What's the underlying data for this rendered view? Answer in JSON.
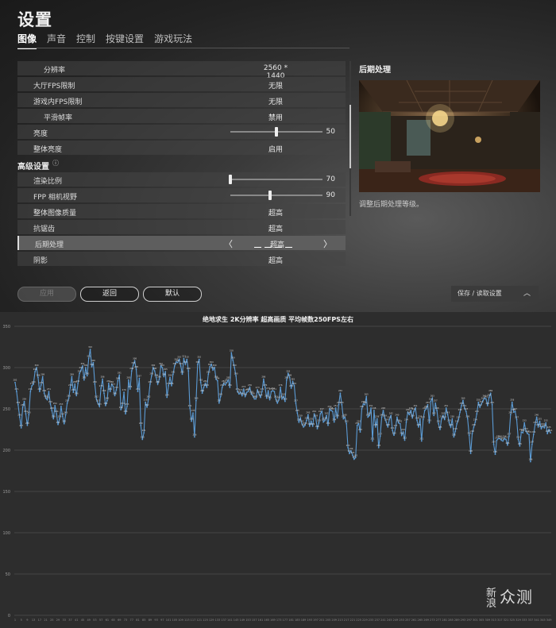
{
  "game": {
    "title": "设置",
    "tabs": [
      {
        "label": "图像",
        "active": true
      },
      {
        "label": "声音",
        "active": false
      },
      {
        "label": "控制",
        "active": false
      },
      {
        "label": "按键设置",
        "active": false
      },
      {
        "label": "游戏玩法",
        "active": false
      }
    ],
    "settings": [
      {
        "label": "分辨率",
        "value": "2560 * 1440",
        "indent": true
      },
      {
        "label": "大厅FPS限制",
        "value": "无限"
      },
      {
        "label": "游戏内FPS限制",
        "value": "无限"
      },
      {
        "label": "平滑帧率",
        "value": "禁用",
        "indent": true
      },
      {
        "label": "亮度",
        "slider": 0.5,
        "value": "50"
      },
      {
        "label": "整体亮度",
        "value": "启用"
      },
      {
        "label": "高级设置",
        "section": true,
        "icon": "info-icon"
      },
      {
        "label": "渲染比例",
        "slider": 0.0,
        "value": "70"
      },
      {
        "label": "FPP 相机视野",
        "slider": 0.43,
        "value": "90"
      },
      {
        "label": "整体图像质量",
        "value": "超高"
      },
      {
        "label": "抗锯齿",
        "value": "超高"
      },
      {
        "label": "后期处理",
        "value": "超高",
        "selected": true,
        "level": 4,
        "levels": 4
      },
      {
        "label": "阴影",
        "value": "超高"
      }
    ],
    "preview_title": "后期处理",
    "preview_desc": "调整后期处理等级。",
    "buttons": {
      "apply": "应用",
      "back": "返回",
      "default": "默认"
    },
    "save_load": "保存 / 读取设置",
    "colors": {
      "line": "#5b9bd5",
      "selected_row": "#5e5e5e"
    }
  },
  "chart_data": {
    "type": "line",
    "title": "绝地求生 2K分辨率 超高画质 平均帧数250FPS左右",
    "ylim": [
      0,
      350
    ],
    "yticks": [
      0,
      50,
      100,
      150,
      200,
      250,
      300,
      350
    ],
    "grid": true,
    "series": [
      {
        "values": [
          282,
          271,
          255,
          240,
          227,
          252,
          259,
          244,
          230,
          243,
          271,
          278,
          280,
          295,
          300,
          288,
          271,
          279,
          289,
          269,
          263,
          261,
          271,
          256,
          248,
          238,
          254,
          244,
          231,
          238,
          253,
          241,
          232,
          243,
          257,
          263,
          276,
          289,
          270,
          280,
          266,
          281,
          293,
          297,
          302,
          285,
          300,
          290,
          311,
          322,
          301,
          306,
          280,
          262,
          257,
          253,
          275,
          286,
          269,
          254,
          260,
          281,
          271,
          280,
          277,
          266,
          273,
          284,
          291,
          249,
          254,
          270,
          244,
          253,
          285,
          274,
          296,
          303,
          308,
          298,
          271,
          287,
          230,
          213,
          221,
          258,
          252,
          262,
          280,
          290,
          300,
          296,
          288,
          280,
          286,
          302,
          300,
          289,
          295,
          264,
          278,
          288,
          278,
          292,
          302,
          307,
          306,
          310,
          302,
          292,
          311,
          304,
          310,
          296,
          251,
          235,
          245,
          216,
          260,
          304,
          310,
          282,
          269,
          276,
          281,
          276,
          292,
          301,
          304,
          297,
          300,
          286,
          284,
          257,
          265,
          276,
          281,
          279,
          282,
          285,
          276,
          318,
          309,
          300,
          290,
          271,
          268,
          270,
          266,
          274,
          265,
          270,
          271,
          276,
          268,
          266,
          262,
          262,
          273,
          268,
          264,
          271,
          286,
          276,
          263,
          272,
          261,
          271,
          272,
          271,
          262,
          257,
          261,
          276,
          262,
          265,
          259,
          285,
          293,
          288,
          275,
          283,
          278,
          257,
          245,
          234,
          239,
          232,
          228,
          230,
          236,
          243,
          229,
          235,
          229,
          244,
          239,
          226,
          233,
          244,
          247,
          234,
          236,
          242,
          230,
          250,
          248,
          247,
          234,
          251,
          239,
          255,
          269,
          255,
          238,
          240,
          232,
          203,
          196,
          199,
          194,
          189,
          191,
          230,
          232,
          222,
          250,
          256,
          255,
          265,
          240,
          242,
          251,
          211,
          248,
          228,
          238,
          203,
          217,
          240,
          248,
          239,
          234,
          228,
          237,
          242,
          224,
          218,
          227,
          240,
          233,
          232,
          218,
          222,
          212,
          234,
          246,
          243,
          248,
          239,
          247,
          251,
          236,
          228,
          238,
          211,
          237,
          248,
          250,
          255,
          233,
          259,
          263,
          242,
          257,
          248,
          232,
          225,
          238,
          242,
          237,
          251,
          243,
          233,
          228,
          238,
          216,
          223,
          232,
          237,
          246,
          254,
          260,
          251,
          247,
          238,
          218,
          196,
          220,
          228,
          234,
          244,
          258,
          252,
          256,
          260,
          263,
          262,
          254,
          264,
          269,
          255,
          207,
          195,
          212,
          214,
          214,
          212,
          211,
          214,
          213,
          206,
          217,
          243,
          258,
          246,
          247,
          237,
          213,
          205,
          222,
          221,
          233,
          223,
          220,
          219,
          186,
          207,
          219,
          231,
          240,
          228,
          235,
          226,
          229,
          227,
          233,
          220,
          225,
          221
        ]
      }
    ]
  },
  "watermark": {
    "small": "新浪",
    "big": "众测"
  }
}
